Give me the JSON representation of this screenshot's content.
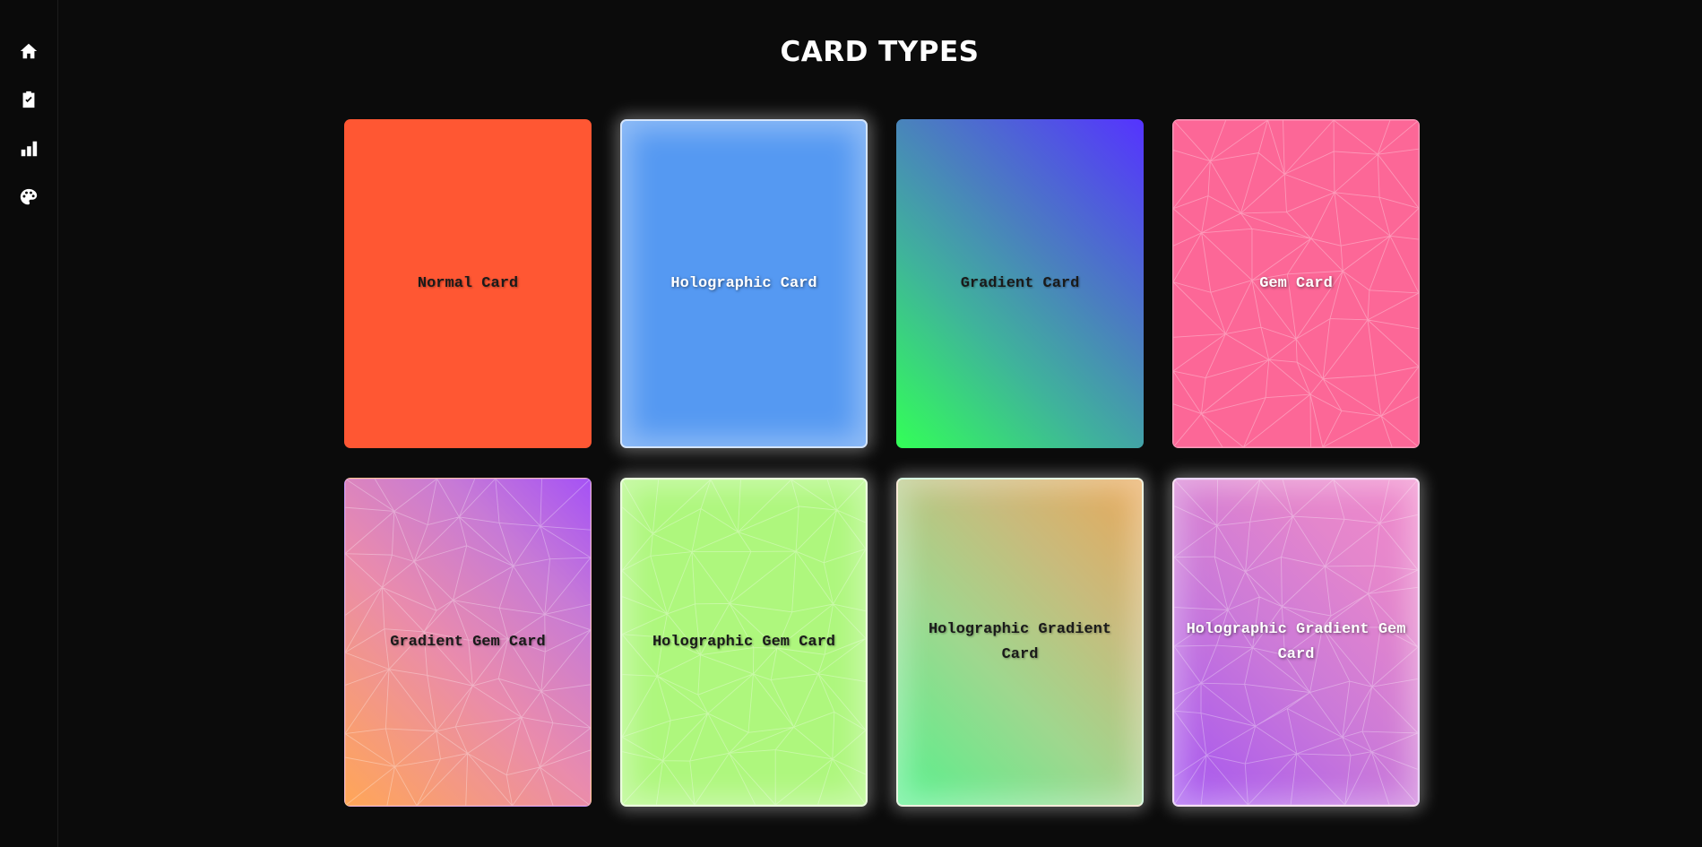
{
  "sidebar": {
    "items": [
      {
        "icon": "home-icon"
      },
      {
        "icon": "clipboard-check-icon"
      },
      {
        "icon": "bar-chart-icon"
      },
      {
        "icon": "palette-icon"
      }
    ]
  },
  "page": {
    "title": "CARD TYPES"
  },
  "cards": [
    {
      "label": "Normal Card",
      "color": "#ff5733"
    },
    {
      "label": "Holographic Card",
      "color": "#5599f2"
    },
    {
      "label": "Gradient Card",
      "colors": [
        "#33ff57",
        "#5533ff"
      ]
    },
    {
      "label": "Gem Card",
      "color": "#fc6797"
    },
    {
      "label": "Gradient Gem Card",
      "colors": [
        "#ffa657",
        "#a552f5"
      ]
    },
    {
      "label": "Holographic Gem Card",
      "color": "#aef77d"
    },
    {
      "label": "Holographic Gradient Card",
      "colors": [
        "#57f08c",
        "#e8a85a"
      ]
    },
    {
      "label": "Holographic Gradient Gem Card",
      "colors": [
        "#a455f0",
        "#f08acb"
      ]
    }
  ]
}
